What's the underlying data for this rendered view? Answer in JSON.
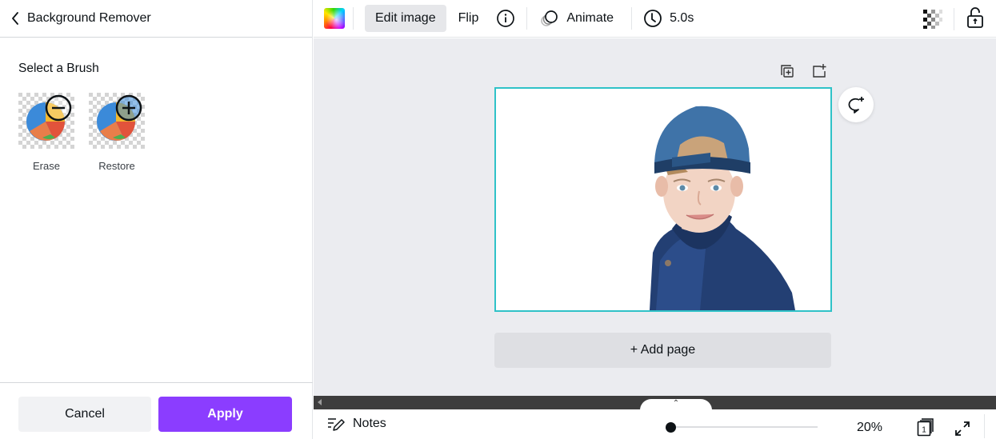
{
  "panel": {
    "title": "Background Remover",
    "section_title": "Select a Brush",
    "brushes": [
      {
        "label": "Erase",
        "icon": "minus-circle-icon"
      },
      {
        "label": "Restore",
        "icon": "plus-circle-icon"
      }
    ],
    "cancel_label": "Cancel",
    "apply_label": "Apply"
  },
  "toolbar": {
    "edit_image_label": "Edit image",
    "flip_label": "Flip",
    "animate_label": "Animate",
    "duration": "5.0s"
  },
  "canvas": {
    "add_page_label": "+ Add page",
    "page_image": "boy-in-blue-cap-cutout"
  },
  "bottombar": {
    "notes_label": "Notes",
    "zoom_percent": 20,
    "zoom_label": "20%",
    "page_count": "1"
  },
  "colors": {
    "accent": "#8b3dff",
    "selection": "#2fc2c8",
    "canvas_bg": "#ebecf0"
  }
}
